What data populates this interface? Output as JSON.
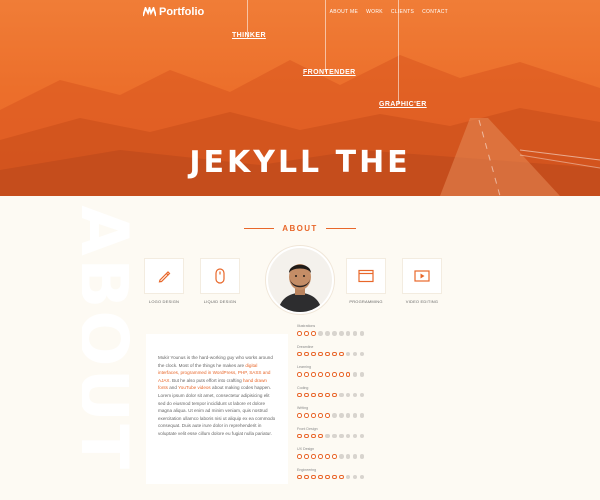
{
  "header": {
    "logo_text": "Portfolio",
    "nav": [
      "ABOUT ME",
      "WORK",
      "CLIENTS",
      "CONTACT"
    ],
    "roles": [
      "THINKER",
      "FRONTENDER",
      "GRAPHIC'ER"
    ],
    "hero_title": "JEKYLL THE"
  },
  "about": {
    "background_word": "ABOUT",
    "heading": "ABOUT",
    "skills": [
      {
        "label": "LOGO DESIGN",
        "icon": "pen-icon"
      },
      {
        "label": "LIQUID DESIGN",
        "icon": "mouse-icon"
      },
      {
        "label": "PROGRAMMING",
        "icon": "browser-window-icon"
      },
      {
        "label": "VIDEO EDITING",
        "icon": "play-button-icon"
      }
    ],
    "avatar_icon": "profile-photo",
    "bio": {
      "p1": "Mukir Younus is the hard-working guy who works around the clock. Most of the things he makes are",
      "p1_link": "digital interfaces, programmed in WordPress, PHP, SASS and AJAX",
      "p2": ". But he also puts effort into crafting",
      "p2_link": "hand drawn fonts",
      "p3": "and",
      "p3_link": "YouTube videos",
      "p4": "about making codes happen.",
      "lorem": "Lorem ipsum dolor sit amet, consectetur adipisicing elit sed do eiusmod tempor incididunt ut labore et dolore magna aliqua. Ut enim ad minim veniam, quis nostrud exercitation ullamco laboris nisi ut aliquip ex ea commodo consequat. Duis aute irure dolor in reprehenderit in voluptate velit esse cillum dolore eu fugiat nulla pariatur."
    },
    "ratings": [
      {
        "label": "Illustrations",
        "value": 3,
        "max": 10
      },
      {
        "label": "Dreamline",
        "value": 7,
        "max": 10
      },
      {
        "label": "Learning",
        "value": 8,
        "max": 10
      },
      {
        "label": "Coding",
        "value": 6,
        "max": 10
      },
      {
        "label": "Writing",
        "value": 5,
        "max": 10
      },
      {
        "label": "Front Design",
        "value": 4,
        "max": 10
      },
      {
        "label": "UX Design",
        "value": 6,
        "max": 10
      },
      {
        "label": "Engineering",
        "value": 7,
        "max": 10
      }
    ]
  },
  "colors": {
    "accent": "#e8672a",
    "background": "#fdfaf3",
    "hero": "#ec6f2b"
  }
}
